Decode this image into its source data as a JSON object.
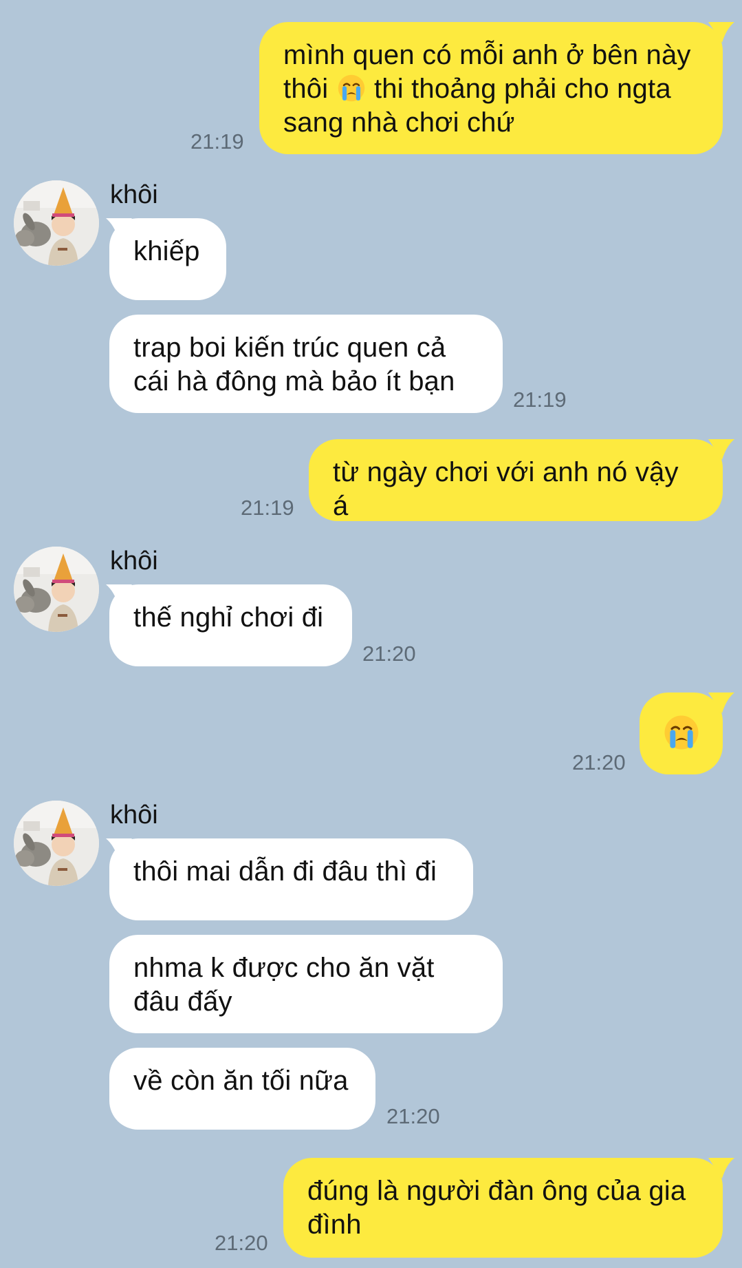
{
  "contact": {
    "name": "khôi",
    "avatar_icon": "boy-with-party-hat-and-rabbit-avatar"
  },
  "colors": {
    "background": "#b2c6d8",
    "my_bubble": "#fdea3f",
    "their_bubble": "#ffffff",
    "timestamp": "#5d6a76"
  },
  "messages": [
    {
      "sender": "me",
      "line1": "mình quen có mỗi anh ở bên này",
      "line2_a": "thôi",
      "line2_emoji": "crying-face-emoji",
      "line2_b": "thi thoảng phải cho ngta",
      "line3": "sang nhà chơi chứ",
      "time": "21:19"
    },
    {
      "sender": "khôi",
      "text": "khiếp"
    },
    {
      "sender": "khôi",
      "line1": "trap boi kiến trúc quen cả",
      "line2": "cái hà đông mà bảo ít bạn",
      "time": "21:19"
    },
    {
      "sender": "me",
      "text": "từ ngày chơi với anh nó vậy á",
      "time": "21:19"
    },
    {
      "sender": "khôi",
      "text": "thế nghỉ chơi đi",
      "time": "21:20"
    },
    {
      "sender": "me",
      "emoji": "crying-face-emoji",
      "time": "21:20"
    },
    {
      "sender": "khôi",
      "text": "thôi mai dẫn đi đâu thì đi"
    },
    {
      "sender": "khôi",
      "line1": "nhma k được cho ăn vặt",
      "line2": "đâu đấy"
    },
    {
      "sender": "khôi",
      "text": "về còn ăn tối nữa",
      "time": "21:20"
    },
    {
      "sender": "me",
      "line1": "đúng là người đàn ông của gia",
      "line2": "đình",
      "time": "21:20"
    }
  ]
}
